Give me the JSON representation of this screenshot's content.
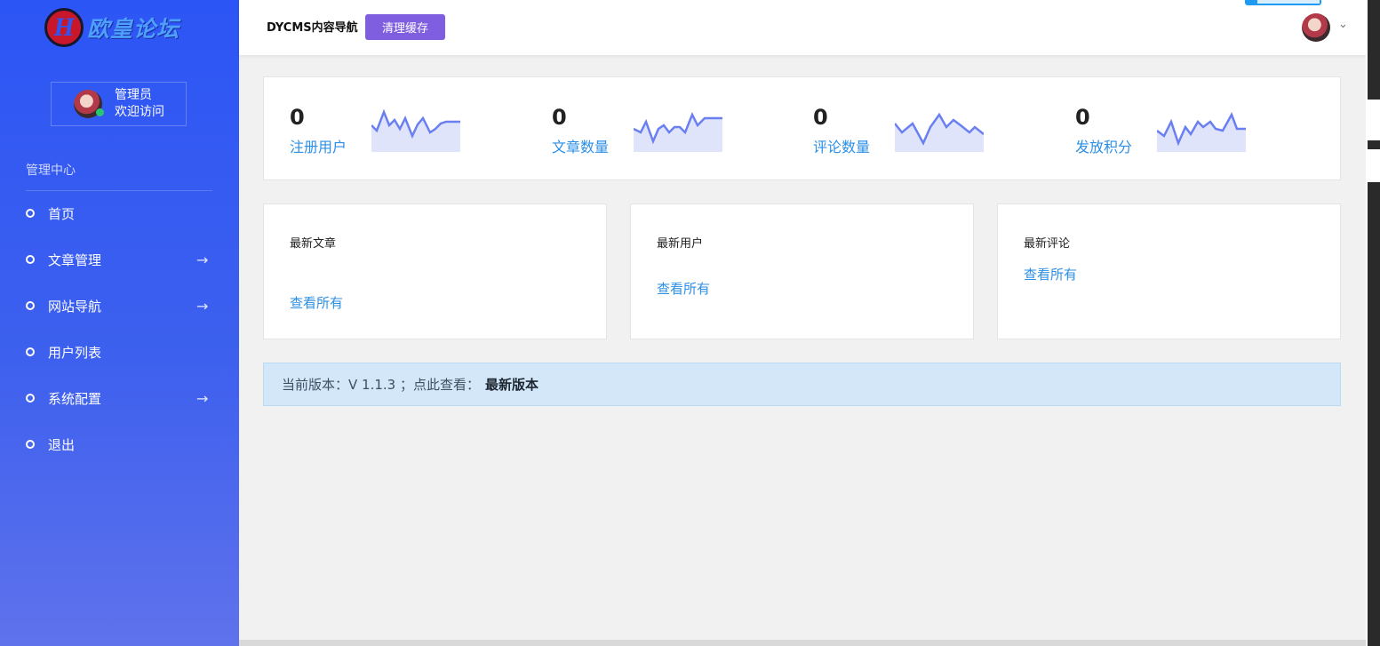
{
  "sidebar": {
    "logo_text": "欧皇论坛",
    "user": {
      "name": "管理员",
      "welcome": "欢迎访问"
    },
    "section_title": "管理中心",
    "items": [
      {
        "label": "首页",
        "has_arrow": false
      },
      {
        "label": "文章管理",
        "has_arrow": true
      },
      {
        "label": "网站导航",
        "has_arrow": true
      },
      {
        "label": "用户列表",
        "has_arrow": false
      },
      {
        "label": "系统配置",
        "has_arrow": true
      },
      {
        "label": "退出",
        "has_arrow": false
      }
    ]
  },
  "header": {
    "brand": "DYCMS内容导航",
    "clear_cache_label": "清理缓存"
  },
  "stats": [
    {
      "value": "0",
      "label": "注册用户"
    },
    {
      "value": "0",
      "label": "文章数量"
    },
    {
      "value": "0",
      "label": "评论数量"
    },
    {
      "value": "0",
      "label": "发放积分"
    }
  ],
  "cards": [
    {
      "title": "最新文章",
      "link": "查看所有"
    },
    {
      "title": "最新用户",
      "link": "查看所有"
    },
    {
      "title": "最新评论",
      "link": "查看所有"
    }
  ],
  "version_notice": {
    "text": "当前版本：V 1.1.3 ；点此查看：",
    "link": "最新版本"
  },
  "colors": {
    "sidebar_top": "#2c55f5",
    "sidebar_bottom": "#5f72ec",
    "accent_link": "#2c8fe6",
    "clear_button": "#7f5fe0",
    "sparkline": "#6a7ff0",
    "alert_bg": "#d3e7f9"
  },
  "icons": {
    "nav_bullet": "circle-outline-icon",
    "nav_arrow": "arrow-right-icon",
    "user_menu": "chevron-down-icon"
  }
}
